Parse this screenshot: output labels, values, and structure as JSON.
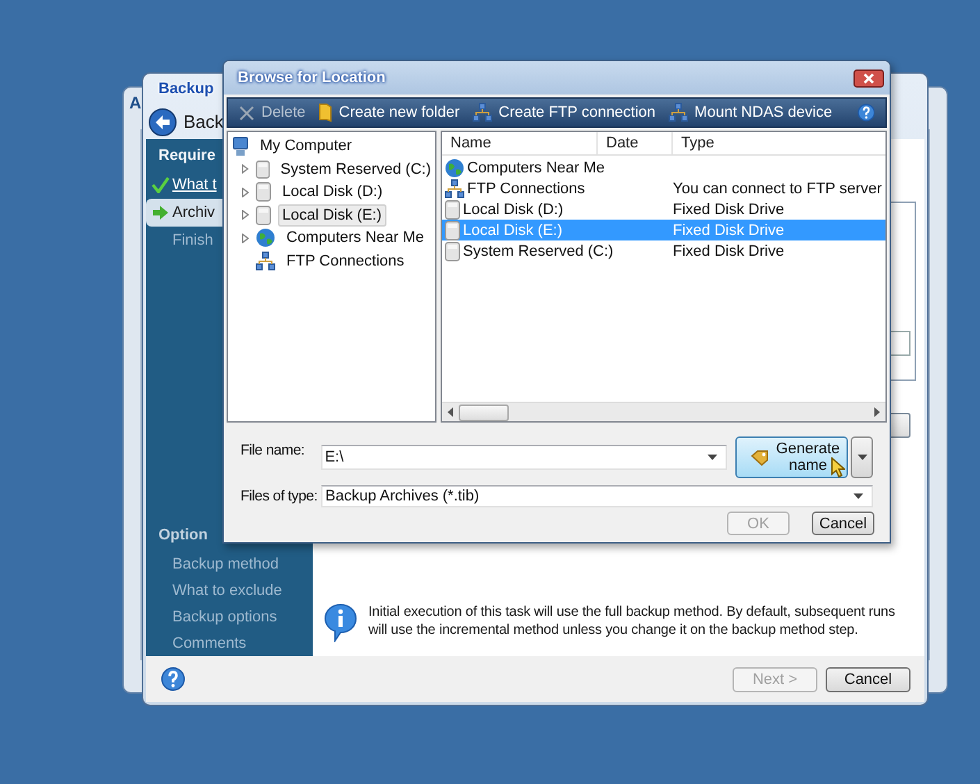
{
  "background_window": {
    "title": "A"
  },
  "wizard": {
    "title": "Backup",
    "heading": "Back",
    "sections": [
      {
        "heading": "Require",
        "steps": [
          {
            "label": "What t",
            "kind": "done",
            "selected": false
          },
          {
            "label": "Archiv",
            "kind": "current",
            "selected": true
          },
          {
            "label": "Finish",
            "kind": "pending",
            "selected": false
          }
        ]
      },
      {
        "heading": "Option",
        "steps": [
          {
            "label": "Backup method",
            "kind": "pending",
            "selected": false
          },
          {
            "label": "What to exclude",
            "kind": "pending",
            "selected": false
          },
          {
            "label": "Backup options",
            "kind": "pending",
            "selected": false
          },
          {
            "label": "Comments",
            "kind": "pending",
            "selected": false
          }
        ]
      }
    ],
    "info_text": "Initial execution of this task will use the full backup method. By default, subsequent runs will use the incremental method unless you change it on the backup method step.",
    "buttons": [
      {
        "label": "Next >",
        "disabled": true
      },
      {
        "label": "Cancel",
        "disabled": false
      }
    ]
  },
  "dialog": {
    "title": "Browse for Location",
    "toolbar": [
      {
        "label": "Delete",
        "kind": "delete",
        "disabled": true
      },
      {
        "label": "Create new folder",
        "kind": "folder",
        "disabled": false
      },
      {
        "label": "Create FTP connection",
        "kind": "network",
        "disabled": false
      },
      {
        "label": "Mount NDAS device",
        "kind": "network",
        "disabled": false
      }
    ],
    "tree": [
      {
        "label": "My Computer",
        "kind": "computer",
        "expandable": false,
        "selected": false,
        "children": [
          {
            "label": "System Reserved (C:)",
            "kind": "disk",
            "expandable": true,
            "selected": false
          },
          {
            "label": "Local Disk (D:)",
            "kind": "disk",
            "expandable": true,
            "selected": false
          },
          {
            "label": "Local Disk (E:)",
            "kind": "disk",
            "expandable": true,
            "selected": true
          },
          {
            "label": "Computers Near Me",
            "kind": "globe",
            "expandable": true,
            "selected": false
          },
          {
            "label": "FTP Connections",
            "kind": "network",
            "expandable": false,
            "selected": false
          }
        ]
      }
    ],
    "list": {
      "columns": [
        "Name",
        "Date",
        "Type"
      ],
      "rows": [
        {
          "name": "Computers Near Me",
          "kind": "globe",
          "selected": false
        },
        {
          "name": "FTP Connections",
          "kind": "network",
          "type": "You can connect to FTP server",
          "selected": false
        },
        {
          "name": "Local Disk (D:)",
          "kind": "disk",
          "type": "Fixed Disk Drive",
          "selected": false
        },
        {
          "name": "Local Disk (E:)",
          "kind": "disk",
          "type": "Fixed Disk Drive",
          "selected": true
        },
        {
          "name": "System Reserved (C:)",
          "kind": "disk",
          "type": "Fixed Disk Drive",
          "selected": false
        }
      ]
    },
    "file_name": {
      "label": "File name:",
      "value": "E:\\"
    },
    "generate_button": {
      "label": "Generate name"
    },
    "file_type": {
      "label": "Files of type:",
      "value": "Backup Archives (*.tib)"
    },
    "buttons": [
      {
        "label": "OK",
        "disabled": true
      },
      {
        "label": "Cancel",
        "disabled": false
      }
    ]
  }
}
